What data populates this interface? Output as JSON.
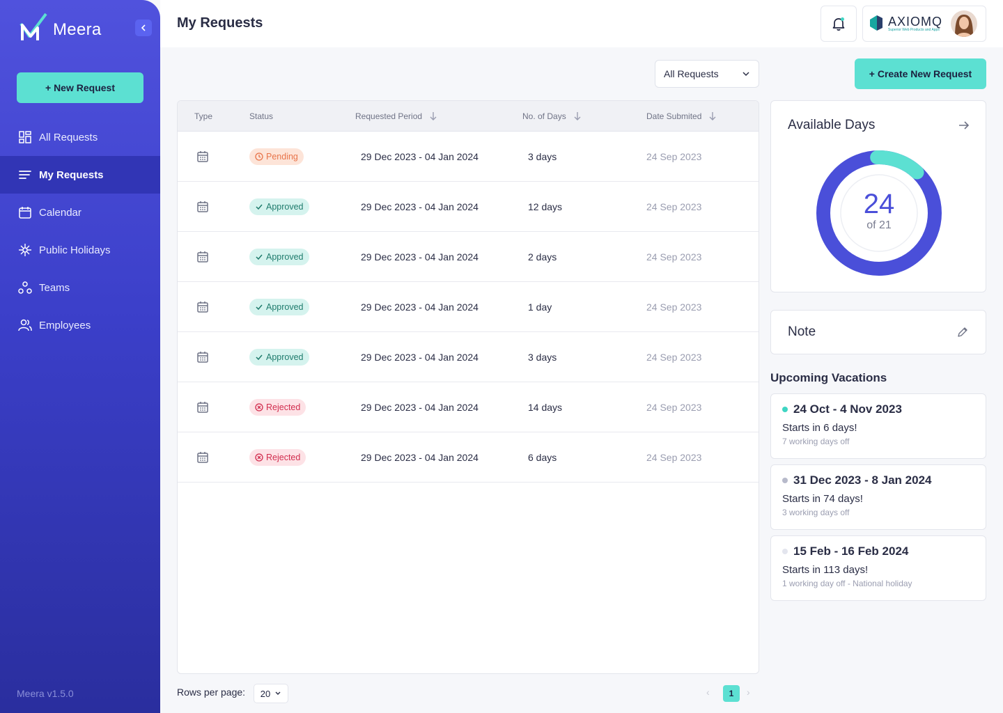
{
  "sidebar": {
    "brand": "Meera",
    "new_request_label": "+ New Request",
    "items": [
      {
        "label": "All Requests",
        "icon": "grid-icon"
      },
      {
        "label": "My Requests",
        "icon": "list-icon"
      },
      {
        "label": "Calendar",
        "icon": "calendar-icon"
      },
      {
        "label": "Public Holidays",
        "icon": "sparkle-icon"
      },
      {
        "label": "Teams",
        "icon": "teams-icon"
      },
      {
        "label": "Employees",
        "icon": "users-icon"
      }
    ],
    "version": "Meera v1.5.0"
  },
  "header": {
    "title": "My Requests",
    "company_name": "AXIOMQ",
    "company_tagline": "Superior Web Products and Apps"
  },
  "filter": {
    "selected": "All Requests",
    "create_label": "+ Create New Request"
  },
  "table": {
    "columns": [
      "Type",
      "Status",
      "Requested Period",
      "No. of Days",
      "Date Submited"
    ],
    "rows": [
      {
        "status": "Pending",
        "period": "29 Dec 2023 - 04 Jan 2024",
        "days": "3 days",
        "submitted": "24 Sep 2023"
      },
      {
        "status": "Approved",
        "period": "29 Dec 2023 - 04 Jan 2024",
        "days": "12 days",
        "submitted": "24 Sep 2023"
      },
      {
        "status": "Approved",
        "period": "29 Dec 2023 - 04 Jan 2024",
        "days": "2 days",
        "submitted": "24 Sep 2023"
      },
      {
        "status": "Approved",
        "period": "29 Dec 2023 - 04 Jan 2024",
        "days": "1 day",
        "submitted": "24 Sep 2023"
      },
      {
        "status": "Approved",
        "period": "29 Dec 2023 - 04 Jan 2024",
        "days": "3 days",
        "submitted": "24 Sep 2023"
      },
      {
        "status": "Rejected",
        "period": "29 Dec 2023 - 04 Jan 2024",
        "days": "14 days",
        "submitted": "24 Sep 2023"
      },
      {
        "status": "Rejected",
        "period": "29 Dec 2023 - 04 Jan 2024",
        "days": "6 days",
        "submitted": "24 Sep 2023"
      }
    ]
  },
  "pagination": {
    "rows_label": "Rows per page:",
    "rows_value": "20",
    "current_page": "1"
  },
  "available": {
    "title": "Available Days",
    "value": "24",
    "of_label": "of 21",
    "highlight_fraction": 0.125
  },
  "note": {
    "title": "Note"
  },
  "upcoming": {
    "title": "Upcoming Vacations",
    "items": [
      {
        "range": "24 Oct - 4 Nov 2023",
        "starts": "Starts in 6 days!",
        "off": "7 working days off",
        "dot_color": "#3fd5c3"
      },
      {
        "range": "31 Dec 2023 - 8 Jan 2024",
        "starts": "Starts in 74 days!",
        "off": "3 working days off",
        "dot_color": "#b7bacb"
      },
      {
        "range": "15 Feb - 16 Feb 2024",
        "starts": "Starts in 113 days!",
        "off": "1 working day off - National holiday",
        "dot_color": "#e3e5ee"
      }
    ]
  },
  "colors": {
    "accent": "#5ce0d2",
    "primary": "#4a4fd9",
    "pending": "#e8744a",
    "approved": "#1e7b6c",
    "rejected": "#d12c4d"
  }
}
